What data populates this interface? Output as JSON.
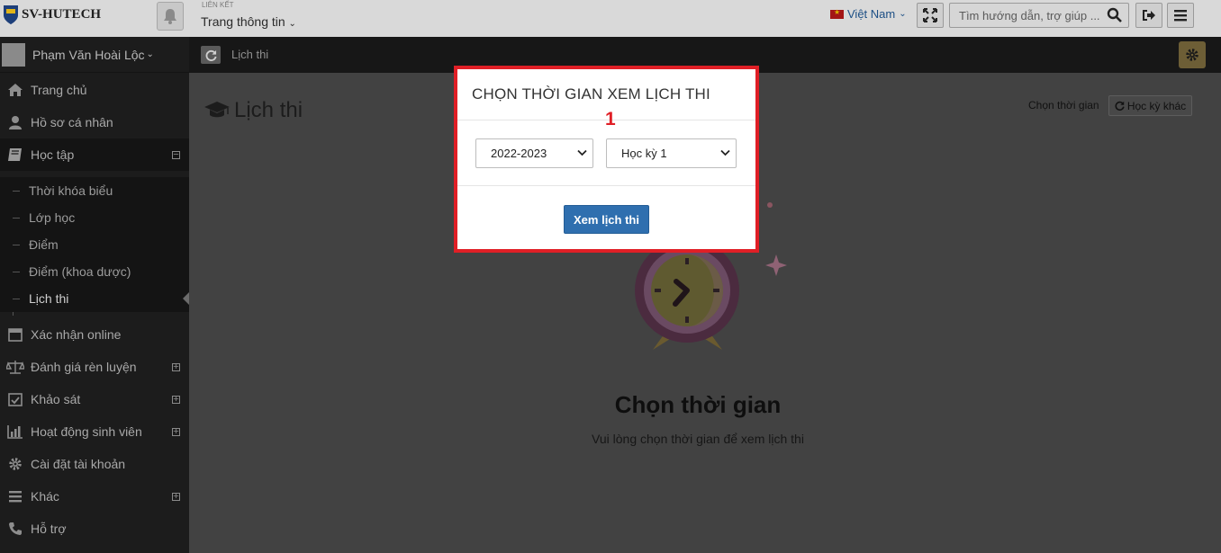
{
  "topbar": {
    "brand": "SV-HUTECH",
    "link_label": "LIÊN KẾT",
    "link_value": "Trang thông tin",
    "language": "Việt Nam",
    "search_placeholder": "Tìm hướng dẫn, trợ giúp ..."
  },
  "sidebar": {
    "user_name": "Phạm Văn Hoài Lộc",
    "items": [
      {
        "label": "Trang chủ",
        "icon": "home-icon"
      },
      {
        "label": "Hồ sơ cá nhân",
        "icon": "user-icon"
      },
      {
        "label": "Học tập",
        "icon": "book-icon"
      },
      {
        "label": "Xác nhận online",
        "icon": "calendar-icon"
      },
      {
        "label": "Đánh giá rèn luyện",
        "icon": "balance-icon"
      },
      {
        "label": "Khảo sát",
        "icon": "calendar-check-icon"
      },
      {
        "label": "Hoạt động sinh viên",
        "icon": "bar-chart-icon"
      },
      {
        "label": "Cài đặt tài khoản",
        "icon": "gear-icon"
      },
      {
        "label": "Khác",
        "icon": "bars-icon"
      },
      {
        "label": "Hỗ trợ",
        "icon": "phone-icon"
      }
    ],
    "sub_items": [
      "Thời khóa biểu",
      "Lớp học",
      "Điểm",
      "Điểm (khoa dược)",
      "Lịch thi"
    ]
  },
  "breadcrumb": {
    "current": "Lịch thi"
  },
  "main": {
    "title": "Lịch thi",
    "time_label": "Chọn thời gian",
    "other_term_button": "Học kỳ khác",
    "empty_title": "Chọn thời gian",
    "empty_desc": "Vui lòng chọn thời gian để xem lịch thi"
  },
  "modal": {
    "title": "CHỌN THỜI GIAN XEM LỊCH THI",
    "step_number": "1",
    "year_value": "2022-2023",
    "term_value": "Học kỳ 1",
    "submit_label": "Xem lịch thi"
  },
  "colors": {
    "accent_red": "#e01f26",
    "button_blue": "#2f6faf",
    "sidebar_bg": "#1c1c1c"
  }
}
